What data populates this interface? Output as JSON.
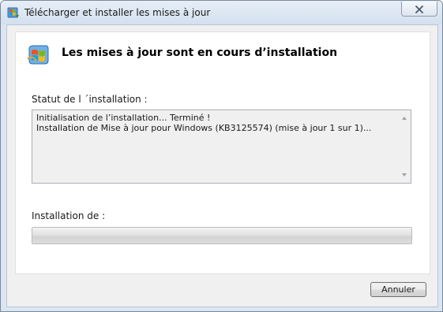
{
  "window": {
    "title": "Télécharger et installer les mises à jour",
    "close_icon": "close-icon",
    "app_icon": "windows-update-icon"
  },
  "main": {
    "heading": "Les mises à jour sont en cours d’installation",
    "status_label": "Statut de l ´installation :",
    "log_lines": [
      "Initialisation de l’installation... Terminé !",
      "Installation de Mise à jour pour Windows (KB3125574) (mise à jour 1 sur 1)..."
    ],
    "progress_label": "Installation de  :",
    "progress_fraction": 0
  },
  "buttons": {
    "cancel": "Annuler"
  },
  "colors": {
    "title_bar": "#dbe6f2",
    "client_background": "#f0f0f0",
    "content_background": "#ffffff"
  }
}
